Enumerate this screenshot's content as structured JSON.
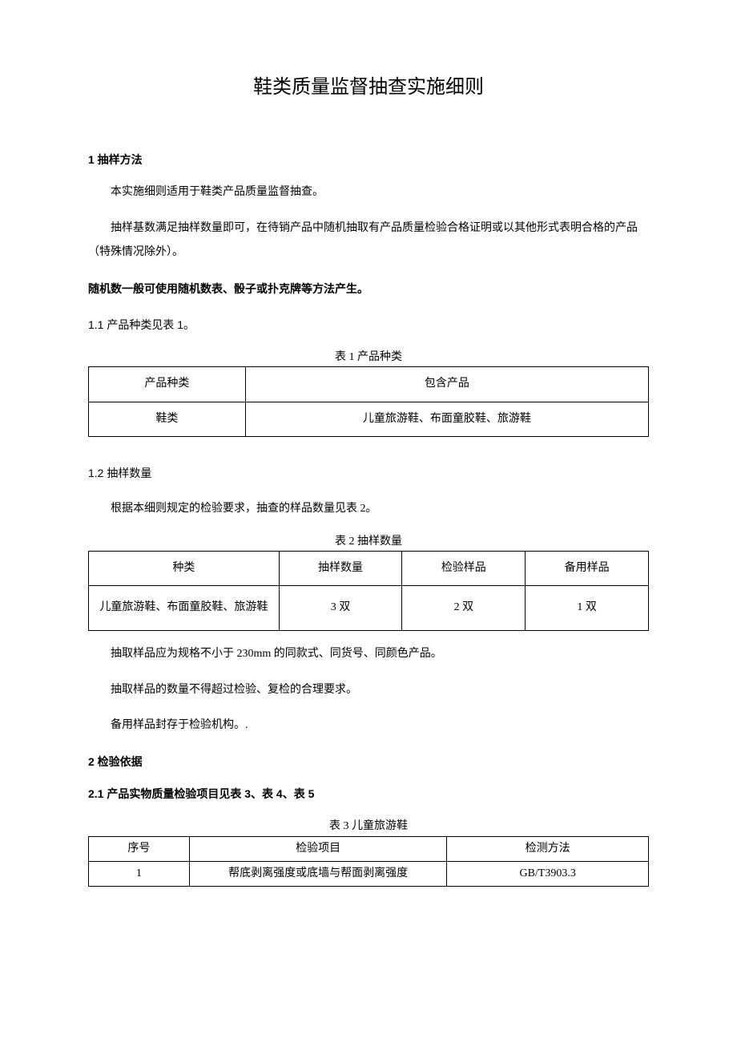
{
  "title": "鞋类质量监督抽查实施细则",
  "section1": {
    "heading": "1 抽样方法",
    "p1": "本实施细则适用于鞋类产品质量监督抽查。",
    "p2": "抽样基数满足抽样数量即可，在待销产品中随机抽取有产品质量检验合格证明或以其他形式表明合格的产品（特殊情况除外）。",
    "p3": "随机数一般可使用随机数表、骰子或扑克牌等方法产生。",
    "sub1": "1.1 产品种类见表 1。",
    "table1": {
      "caption": "表 1 产品种类",
      "headers": [
        "产品种类",
        "包含产品"
      ],
      "rows": [
        [
          "鞋类",
          "儿童旅游鞋、布面童胶鞋、旅游鞋"
        ]
      ]
    },
    "sub2": "1.2 抽样数量",
    "p4": "根据本细则规定的检验要求，抽查的样品数量见表 2。",
    "table2": {
      "caption": "表 2 抽样数量",
      "headers": [
        "种类",
        "抽样数量",
        "检验样品",
        "备用样品"
      ],
      "rows": [
        [
          "儿童旅游鞋、布面童胶鞋、旅游鞋",
          "3 双",
          "2 双",
          "1 双"
        ]
      ]
    },
    "p5": "抽取样品应为规格不小于 230mm 的同款式、同货号、同颜色产品。",
    "p6": "抽取样品的数量不得超过检验、复检的合理要求。",
    "p7": "备用样品封存于检验机构。."
  },
  "section2": {
    "heading": "2 检验依据",
    "sub1": "2.1 产品实物质量检验项目见表 3、表 4、表 5",
    "table3": {
      "caption": "表 3 儿童旅游鞋",
      "headers": [
        "序号",
        "检验项目",
        "检测方法"
      ],
      "rows": [
        [
          "1",
          "帮底剥离强度或底墙与帮面剥离强度",
          "GB/T3903.3"
        ]
      ]
    }
  }
}
